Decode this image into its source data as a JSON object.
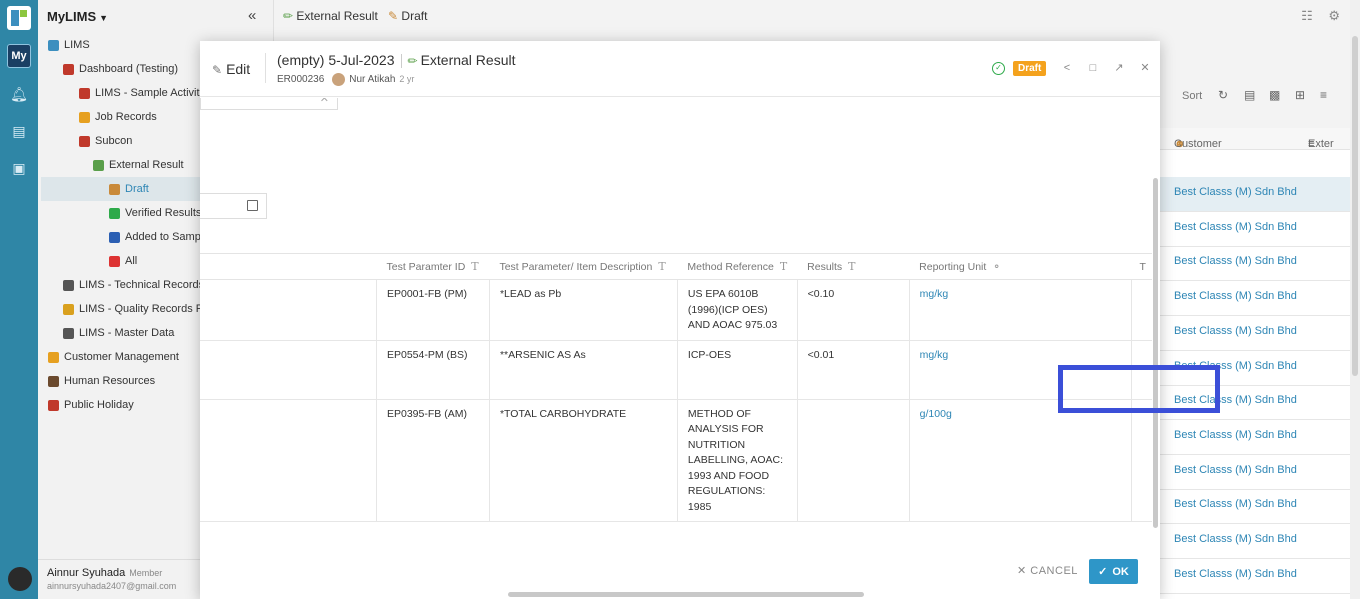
{
  "app": {
    "name": "MyLIMS",
    "rail_badge": "My"
  },
  "breadcrumb": [
    {
      "label": "External Result",
      "icon": "paperclip-icon"
    },
    {
      "label": "Draft",
      "icon": "draft-icon"
    }
  ],
  "sidebar": {
    "items": [
      {
        "label": "LIMS",
        "icon": "globe-icon",
        "color": "#3c8fbf"
      },
      {
        "label": "Dashboard (Testing)",
        "icon": "person-icon",
        "color": "#c0392b"
      },
      {
        "label": "LIMS - Sample Activities",
        "icon": "flask-icon",
        "color": "#c0392b"
      },
      {
        "label": "Job Records",
        "icon": "warning-icon",
        "color": "#e6a020"
      },
      {
        "label": "Subcon",
        "icon": "upload-icon",
        "color": "#c0392b"
      },
      {
        "label": "External Result",
        "icon": "paperclip-icon",
        "color": "#5a9f4a"
      },
      {
        "label": "Draft",
        "icon": "draft-icon",
        "color": "#c98a3a"
      },
      {
        "label": "Verified Results",
        "icon": "check-box-icon",
        "color": "#2eaa4a"
      },
      {
        "label": "Added to Sample",
        "icon": "word-icon",
        "color": "#2b5fb3"
      },
      {
        "label": "All",
        "icon": "circle-icon",
        "color": "#d33"
      },
      {
        "label": "LIMS - Technical Records F",
        "icon": "tools-icon",
        "color": "#555"
      },
      {
        "label": "LIMS - Quality Records For",
        "icon": "sun-icon",
        "color": "#d9a01e"
      },
      {
        "label": "LIMS - Master Data",
        "icon": "gear-icon",
        "color": "#555"
      },
      {
        "label": "Customer Management",
        "icon": "smile-icon",
        "color": "#e6a020"
      },
      {
        "label": "Human Resources",
        "icon": "image-icon",
        "color": "#6b4a2e"
      },
      {
        "label": "Public Holiday",
        "icon": "calendar-icon",
        "color": "#c0392b"
      }
    ]
  },
  "user": {
    "name": "Ainnur Syuhada",
    "role": "Member",
    "email": "ainnursyuhada2407@gmail.com"
  },
  "background_list": {
    "sort_label": "Sort",
    "columns": [
      "Customer",
      "Exter"
    ],
    "rows": [
      "Best Classs (M) Sdn Bhd",
      "Best Classs (M) Sdn Bhd",
      "Best Classs (M) Sdn Bhd",
      "Best Classs (M) Sdn Bhd",
      "Best Classs (M) Sdn Bhd",
      "Best Classs (M) Sdn Bhd",
      "Best Classs (M) Sdn Bhd",
      "Best Classs (M) Sdn Bhd",
      "Best Classs (M) Sdn Bhd",
      "Best Classs (M) Sdn Bhd",
      "Best Classs (M) Sdn Bhd",
      "Best Classs (M) Sdn Bhd",
      "Best Classs (M) Sdn Bhd"
    ]
  },
  "modal": {
    "edit_label": "Edit",
    "title": "(empty) 5-Jul-2023",
    "type": "External Result",
    "record_id": "ER000236",
    "author": "Nur Atikah",
    "age": "2 yr",
    "status": "Draft",
    "status_color": "#f4a21d",
    "table": {
      "columns": [
        "Test Paramter ID",
        "Test Parameter/ Item Description",
        "Method Reference",
        "Results",
        "Reporting Unit",
        "T"
      ],
      "rows": [
        {
          "id": "EP0001-FB (PM)",
          "desc": "*LEAD as Pb",
          "method": "US EPA 6010B (1996)(ICP OES) AND AOAC 975.03",
          "result": "<0.10",
          "unit": "mg/kg"
        },
        {
          "id": "EP0554-PM (BS)",
          "desc": "**ARSENIC AS As",
          "method": "ICP-OES",
          "result": "<0.01",
          "unit": "mg/kg"
        },
        {
          "id": "EP0395-FB (AM)",
          "desc": "*TOTAL CARBOHYDRATE",
          "method": "METHOD OF ANALYSIS FOR NUTRITION LABELLING, AOAC: 1993 AND FOOD REGULATIONS: 1985",
          "result": "",
          "unit": "g/100g"
        }
      ]
    },
    "cancel_label": "CANCEL",
    "ok_label": "OK"
  }
}
